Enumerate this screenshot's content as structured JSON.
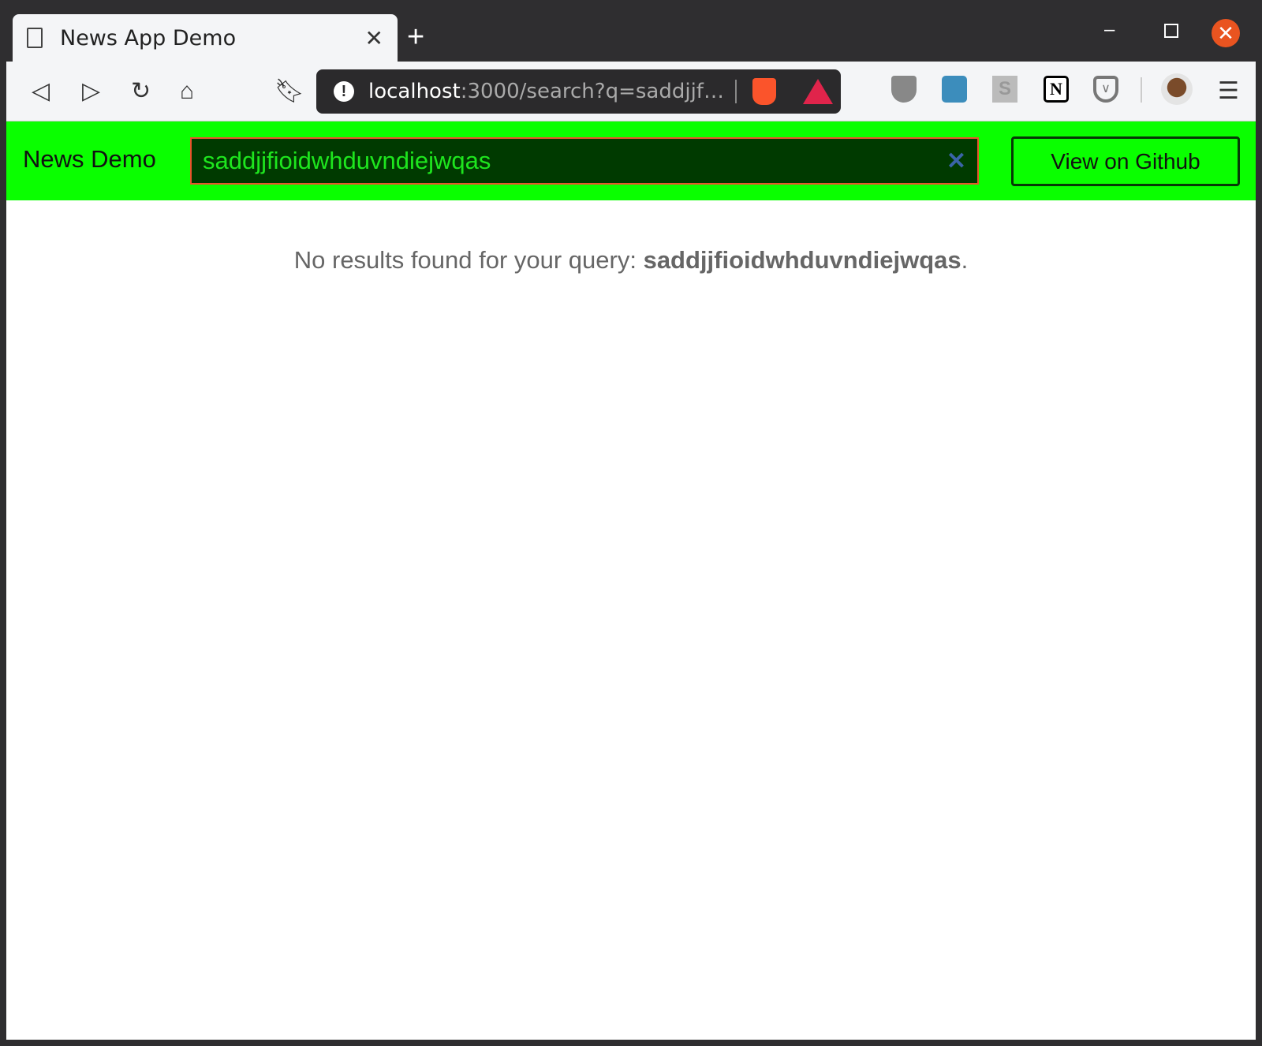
{
  "browser": {
    "tab_title": "News App Demo",
    "url_host": "localhost",
    "url_rest": ":3000/search?q=saddjjf…",
    "icons": [
      "page-icon",
      "back-icon",
      "forward-icon",
      "reload-icon",
      "home-icon",
      "bookmark-icon",
      "site-warning-icon",
      "brave-shields-icon",
      "brave-rewards-icon",
      "ublock-icon",
      "bitwarden-icon",
      "s-extension-icon",
      "notion-icon",
      "pocket-icon",
      "profile-avatar",
      "menu-icon"
    ]
  },
  "header": {
    "brand": "News Demo",
    "search_value": "saddjjfioidwhduvndiejwqas",
    "github_label": "View on Github"
  },
  "results": {
    "prefix": "No results found for your query: ",
    "query": "saddjjfioidwhduvndiejwqas",
    "suffix": "."
  },
  "colors": {
    "header_bg": "#0aff00",
    "input_bg": "#003a00",
    "input_border": "#e8542c",
    "input_text": "#1ee61e"
  }
}
